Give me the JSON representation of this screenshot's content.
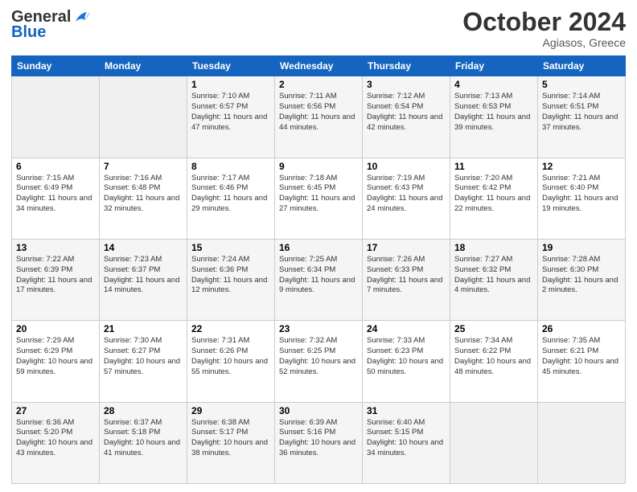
{
  "header": {
    "logo_line1": "General",
    "logo_line2": "Blue",
    "month": "October 2024",
    "location": "Agiasos, Greece"
  },
  "days_of_week": [
    "Sunday",
    "Monday",
    "Tuesday",
    "Wednesday",
    "Thursday",
    "Friday",
    "Saturday"
  ],
  "weeks": [
    [
      {
        "day": "",
        "empty": true
      },
      {
        "day": "",
        "empty": true
      },
      {
        "day": "1",
        "sunrise": "7:10 AM",
        "sunset": "6:57 PM",
        "daylight": "11 hours and 47 minutes."
      },
      {
        "day": "2",
        "sunrise": "7:11 AM",
        "sunset": "6:56 PM",
        "daylight": "11 hours and 44 minutes."
      },
      {
        "day": "3",
        "sunrise": "7:12 AM",
        "sunset": "6:54 PM",
        "daylight": "11 hours and 42 minutes."
      },
      {
        "day": "4",
        "sunrise": "7:13 AM",
        "sunset": "6:53 PM",
        "daylight": "11 hours and 39 minutes."
      },
      {
        "day": "5",
        "sunrise": "7:14 AM",
        "sunset": "6:51 PM",
        "daylight": "11 hours and 37 minutes."
      }
    ],
    [
      {
        "day": "6",
        "sunrise": "7:15 AM",
        "sunset": "6:49 PM",
        "daylight": "11 hours and 34 minutes."
      },
      {
        "day": "7",
        "sunrise": "7:16 AM",
        "sunset": "6:48 PM",
        "daylight": "11 hours and 32 minutes."
      },
      {
        "day": "8",
        "sunrise": "7:17 AM",
        "sunset": "6:46 PM",
        "daylight": "11 hours and 29 minutes."
      },
      {
        "day": "9",
        "sunrise": "7:18 AM",
        "sunset": "6:45 PM",
        "daylight": "11 hours and 27 minutes."
      },
      {
        "day": "10",
        "sunrise": "7:19 AM",
        "sunset": "6:43 PM",
        "daylight": "11 hours and 24 minutes."
      },
      {
        "day": "11",
        "sunrise": "7:20 AM",
        "sunset": "6:42 PM",
        "daylight": "11 hours and 22 minutes."
      },
      {
        "day": "12",
        "sunrise": "7:21 AM",
        "sunset": "6:40 PM",
        "daylight": "11 hours and 19 minutes."
      }
    ],
    [
      {
        "day": "13",
        "sunrise": "7:22 AM",
        "sunset": "6:39 PM",
        "daylight": "11 hours and 17 minutes."
      },
      {
        "day": "14",
        "sunrise": "7:23 AM",
        "sunset": "6:37 PM",
        "daylight": "11 hours and 14 minutes."
      },
      {
        "day": "15",
        "sunrise": "7:24 AM",
        "sunset": "6:36 PM",
        "daylight": "11 hours and 12 minutes."
      },
      {
        "day": "16",
        "sunrise": "7:25 AM",
        "sunset": "6:34 PM",
        "daylight": "11 hours and 9 minutes."
      },
      {
        "day": "17",
        "sunrise": "7:26 AM",
        "sunset": "6:33 PM",
        "daylight": "11 hours and 7 minutes."
      },
      {
        "day": "18",
        "sunrise": "7:27 AM",
        "sunset": "6:32 PM",
        "daylight": "11 hours and 4 minutes."
      },
      {
        "day": "19",
        "sunrise": "7:28 AM",
        "sunset": "6:30 PM",
        "daylight": "11 hours and 2 minutes."
      }
    ],
    [
      {
        "day": "20",
        "sunrise": "7:29 AM",
        "sunset": "6:29 PM",
        "daylight": "10 hours and 59 minutes."
      },
      {
        "day": "21",
        "sunrise": "7:30 AM",
        "sunset": "6:27 PM",
        "daylight": "10 hours and 57 minutes."
      },
      {
        "day": "22",
        "sunrise": "7:31 AM",
        "sunset": "6:26 PM",
        "daylight": "10 hours and 55 minutes."
      },
      {
        "day": "23",
        "sunrise": "7:32 AM",
        "sunset": "6:25 PM",
        "daylight": "10 hours and 52 minutes."
      },
      {
        "day": "24",
        "sunrise": "7:33 AM",
        "sunset": "6:23 PM",
        "daylight": "10 hours and 50 minutes."
      },
      {
        "day": "25",
        "sunrise": "7:34 AM",
        "sunset": "6:22 PM",
        "daylight": "10 hours and 48 minutes."
      },
      {
        "day": "26",
        "sunrise": "7:35 AM",
        "sunset": "6:21 PM",
        "daylight": "10 hours and 45 minutes."
      }
    ],
    [
      {
        "day": "27",
        "sunrise": "6:36 AM",
        "sunset": "5:20 PM",
        "daylight": "10 hours and 43 minutes."
      },
      {
        "day": "28",
        "sunrise": "6:37 AM",
        "sunset": "5:18 PM",
        "daylight": "10 hours and 41 minutes."
      },
      {
        "day": "29",
        "sunrise": "6:38 AM",
        "sunset": "5:17 PM",
        "daylight": "10 hours and 38 minutes."
      },
      {
        "day": "30",
        "sunrise": "6:39 AM",
        "sunset": "5:16 PM",
        "daylight": "10 hours and 36 minutes."
      },
      {
        "day": "31",
        "sunrise": "6:40 AM",
        "sunset": "5:15 PM",
        "daylight": "10 hours and 34 minutes."
      },
      {
        "day": "",
        "empty": true
      },
      {
        "day": "",
        "empty": true
      }
    ]
  ]
}
